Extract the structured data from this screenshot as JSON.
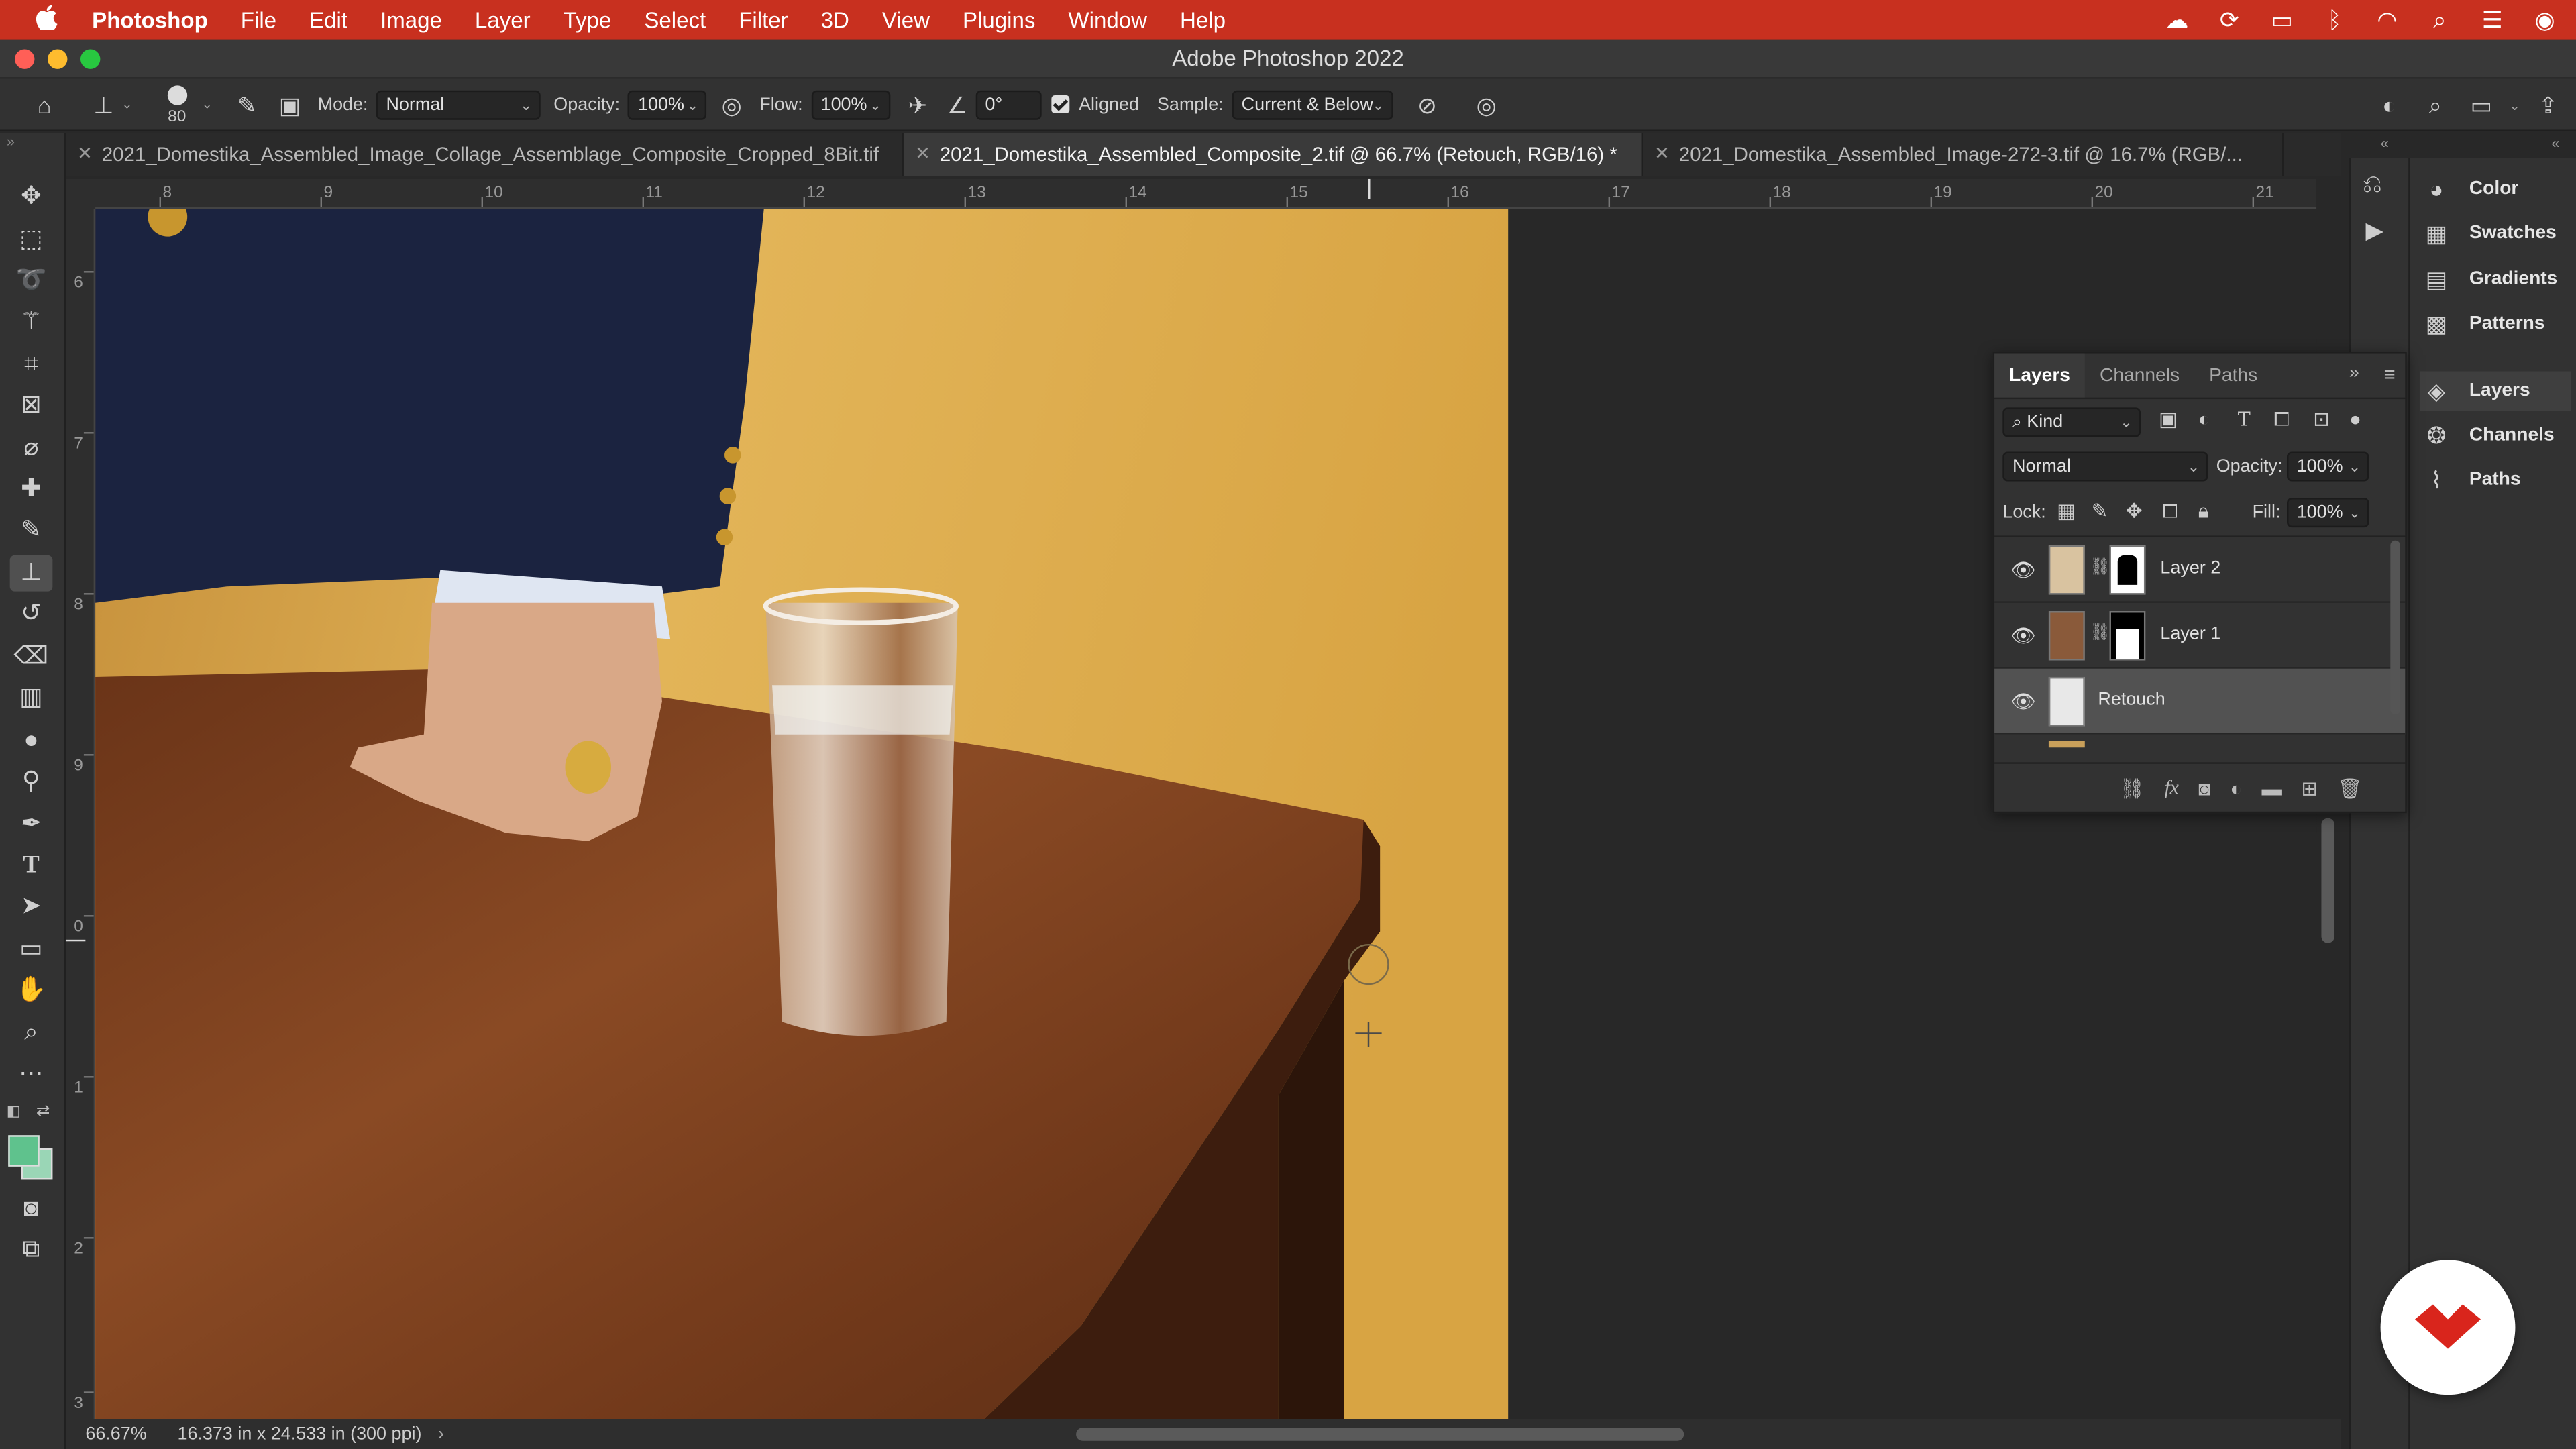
{
  "menubar": {
    "apple": "",
    "app_name": "Photoshop",
    "items": [
      "File",
      "Edit",
      "Image",
      "Layer",
      "Type",
      "Select",
      "Filter",
      "3D",
      "View",
      "Plugins",
      "Window",
      "Help"
    ]
  },
  "window": {
    "title": "Adobe Photoshop 2022"
  },
  "options": {
    "brush_size": "80",
    "mode_label": "Mode:",
    "mode_value": "Normal",
    "opacity_label": "Opacity:",
    "opacity_value": "100%",
    "flow_label": "Flow:",
    "flow_value": "100%",
    "angle_value": "0°",
    "aligned_label": "Aligned",
    "sample_label": "Sample:",
    "sample_value": "Current & Below"
  },
  "tabs": [
    {
      "label": "2021_Domestika_Assembled_Image_Collage_Assemblage_Composite_Cropped_8Bit.tif"
    },
    {
      "label": "2021_Domestika_Assembled_Composite_2.tif @ 66.7% (Retouch, RGB/16) *"
    },
    {
      "label": "2021_Domestika_Assembled_Image-272-3.tif @ 16.7% (RGB/..."
    }
  ],
  "ruler": {
    "h_ticks": [
      "8",
      "9",
      "10",
      "11",
      "12",
      "13",
      "14",
      "15",
      "16",
      "17",
      "18",
      "19",
      "20",
      "21"
    ],
    "v_ticks": [
      "6",
      "7",
      "8",
      "9",
      "0",
      "1",
      "2",
      "3"
    ]
  },
  "status": {
    "zoom": "66.67%",
    "doc_size": "16.373 in x 24.533 in (300 ppi)"
  },
  "right_panels": {
    "top": [
      "Color",
      "Swatches",
      "Gradients",
      "Patterns"
    ],
    "bottom": [
      "Layers",
      "Channels",
      "Paths"
    ]
  },
  "layers_panel": {
    "tabs": [
      "Layers",
      "Channels",
      "Paths"
    ],
    "filter_kind": "Kind",
    "blend_mode": "Normal",
    "opacity_label": "Opacity:",
    "opacity_value": "100%",
    "lock_label": "Lock:",
    "fill_label": "Fill:",
    "fill_value": "100%",
    "layers": [
      {
        "name": "Layer 2"
      },
      {
        "name": "Layer 1"
      },
      {
        "name": "Retouch"
      }
    ]
  },
  "colors": {
    "menubar": "#c8301f",
    "foreground": "#5fc28d",
    "background": "#9ad6b6",
    "brand_logo": "#d9251c"
  }
}
